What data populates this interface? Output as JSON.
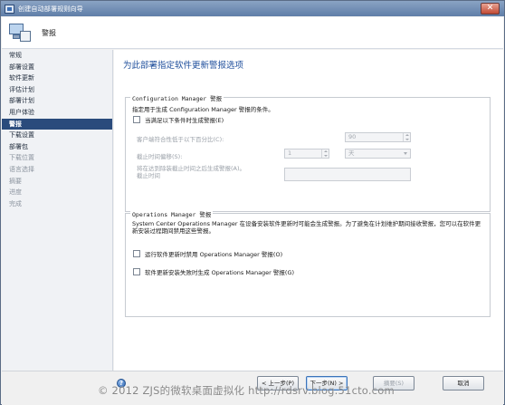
{
  "window": {
    "title": "创建自动部署规则向导",
    "close_label": "✕"
  },
  "header": {
    "title": "警报"
  },
  "sidebar": {
    "items": [
      {
        "label": "常规",
        "state": "normal"
      },
      {
        "label": "部署设置",
        "state": "normal"
      },
      {
        "label": "软件更新",
        "state": "normal"
      },
      {
        "label": "评估计划",
        "state": "normal"
      },
      {
        "label": "部署计划",
        "state": "normal"
      },
      {
        "label": "用户体验",
        "state": "normal"
      },
      {
        "label": "警报",
        "state": "active"
      },
      {
        "label": "下载设置",
        "state": "normal"
      },
      {
        "label": "部署包",
        "state": "normal"
      },
      {
        "label": "下载位置",
        "state": "disabled"
      },
      {
        "label": "语言选择",
        "state": "disabled"
      },
      {
        "label": "摘要",
        "state": "disabled"
      },
      {
        "label": "进度",
        "state": "disabled"
      },
      {
        "label": "完成",
        "state": "disabled"
      }
    ]
  },
  "main": {
    "page_title": "为此部署指定软件更新警报选项",
    "configmgr_group": {
      "legend": "Configuration Manager 警报",
      "description": "指定用于生成 Configuration Manager 警报的条件。",
      "checkbox_label": "当满足以下条件时生成警报(E)",
      "compliance_label": "客户端符合性低于以下百分比(C):",
      "compliance_value": "90",
      "offset_label": "截止时间偏移(S):",
      "offset_value": "1",
      "offset_unit": "天",
      "alert_time_label_line1": "将在达到除装截止时间之后生成警报(A)。",
      "alert_time_label_line2": "截止时间"
    },
    "opsmgr_group": {
      "legend": "Operations Manager 警报",
      "description": "System Center Operations Manager 在设备安装软件更新时可能会生成警报。为了避免在计划维护期间接收警报，您可以在软件更新安装过程期间禁用这些警报。",
      "checkbox1_label": "运行软件更新时禁用 Operations Manager 警报(O)",
      "checkbox2_label": "软件更新安装失败时生成 Operations Manager 警报(G)"
    }
  },
  "footer": {
    "help_glyph": "?",
    "prev_label": "< 上一步(P)",
    "next_label": "下一步(N) >",
    "summary_label": "摘要(S)",
    "cancel_label": "取消"
  },
  "watermark": "© 2012 ZJS的微软桌面虚拟化 http://rdsrv.blog.51cto.com"
}
